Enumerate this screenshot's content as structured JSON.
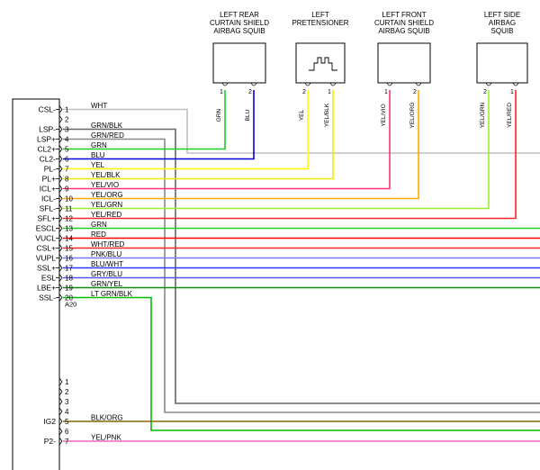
{
  "colors": {
    "WHT": "#c0c0c0",
    "GRN": "#22cc22",
    "BLU": "#0000dd",
    "YEL": "#ffff00",
    "YEL/BLK": "#eeee00",
    "YEL/VIO": "#ff3377",
    "YEL/ORG": "#ffaa00",
    "YEL/GRN": "#99ee33",
    "YEL/RED": "#ff2222",
    "RED": "#ff0000",
    "WHT/RED": "#ff2222",
    "PNK/BLU": "#7777ff",
    "BLU/WHT": "#3333ff",
    "GRY/BLU": "#5555ee",
    "GRN/YEL": "#118811",
    "LT GRN/BLK": "#00bb00",
    "GRN/BLK": "#666666",
    "GRN/RED": "#888888",
    "BLK/ORG": "#886600",
    "YEL/PNK": "#ee66cc"
  },
  "components": [
    {
      "title": [
        "LEFT REAR",
        "CURTAIN SHIELD",
        "AIRBAG SQUIB"
      ],
      "pins": [
        "1",
        "2"
      ],
      "wires": [
        "GRN",
        "BLU"
      ]
    },
    {
      "title": [
        "LEFT",
        "PRETENSIONER"
      ],
      "pins": [
        "2",
        "1"
      ],
      "wires": [
        "YEL",
        "YEL/BLK"
      ]
    },
    {
      "title": [
        "LEFT FRONT",
        "CURTAIN SHIELD",
        "AIRBAG SQUIB"
      ],
      "pins": [
        "1",
        "2"
      ],
      "wires": [
        "YEL/VIO",
        "YEL/ORG"
      ]
    },
    {
      "title": [
        "LEFT SIDE",
        "AIRBAG",
        "SQUIB"
      ],
      "pins": [
        "2",
        "1"
      ],
      "wires": [
        "YEL/GRN",
        "YEL/RED"
      ]
    }
  ],
  "connector_a": {
    "label": "A20",
    "rows": [
      {
        "pin": "1",
        "signal": "CSL-",
        "wire": "WHT"
      },
      {
        "pin": "2",
        "signal": "",
        "wire": ""
      },
      {
        "pin": "3",
        "signal": "LSP-",
        "wire": "GRN/BLK"
      },
      {
        "pin": "4",
        "signal": "LSP+",
        "wire": "GRN/RED"
      },
      {
        "pin": "5",
        "signal": "CL2+",
        "wire": "GRN"
      },
      {
        "pin": "6",
        "signal": "CL2-",
        "wire": "BLU"
      },
      {
        "pin": "7",
        "signal": "PL-",
        "wire": "YEL"
      },
      {
        "pin": "8",
        "signal": "PL+",
        "wire": "YEL/BLK"
      },
      {
        "pin": "9",
        "signal": "ICL+",
        "wire": "YEL/VIO"
      },
      {
        "pin": "10",
        "signal": "ICL-",
        "wire": "YEL/ORG"
      },
      {
        "pin": "11",
        "signal": "SFL-",
        "wire": "YEL/GRN"
      },
      {
        "pin": "12",
        "signal": "SFL+",
        "wire": "YEL/RED"
      },
      {
        "pin": "13",
        "signal": "ESCL",
        "wire": "GRN"
      },
      {
        "pin": "14",
        "signal": "VUCL",
        "wire": "RED"
      },
      {
        "pin": "15",
        "signal": "CSL+",
        "wire": "WHT/RED"
      },
      {
        "pin": "16",
        "signal": "VUPL",
        "wire": "PNK/BLU"
      },
      {
        "pin": "17",
        "signal": "SSL+",
        "wire": "BLU/WHT"
      },
      {
        "pin": "18",
        "signal": "ESL",
        "wire": "GRY/BLU"
      },
      {
        "pin": "19",
        "signal": "LBE+",
        "wire": "GRN/YEL"
      },
      {
        "pin": "20",
        "signal": "SSL-",
        "wire": "LT GRN/BLK"
      }
    ]
  },
  "connector_b": {
    "rows": [
      {
        "pin": "1",
        "signal": "",
        "wire": ""
      },
      {
        "pin": "2",
        "signal": "",
        "wire": ""
      },
      {
        "pin": "3",
        "signal": "",
        "wire": ""
      },
      {
        "pin": "4",
        "signal": "",
        "wire": ""
      },
      {
        "pin": "5",
        "signal": "IG2",
        "wire": "BLK/ORG"
      },
      {
        "pin": "6",
        "signal": "",
        "wire": ""
      },
      {
        "pin": "7",
        "signal": "P2-",
        "wire": "YEL/PNK"
      }
    ]
  }
}
